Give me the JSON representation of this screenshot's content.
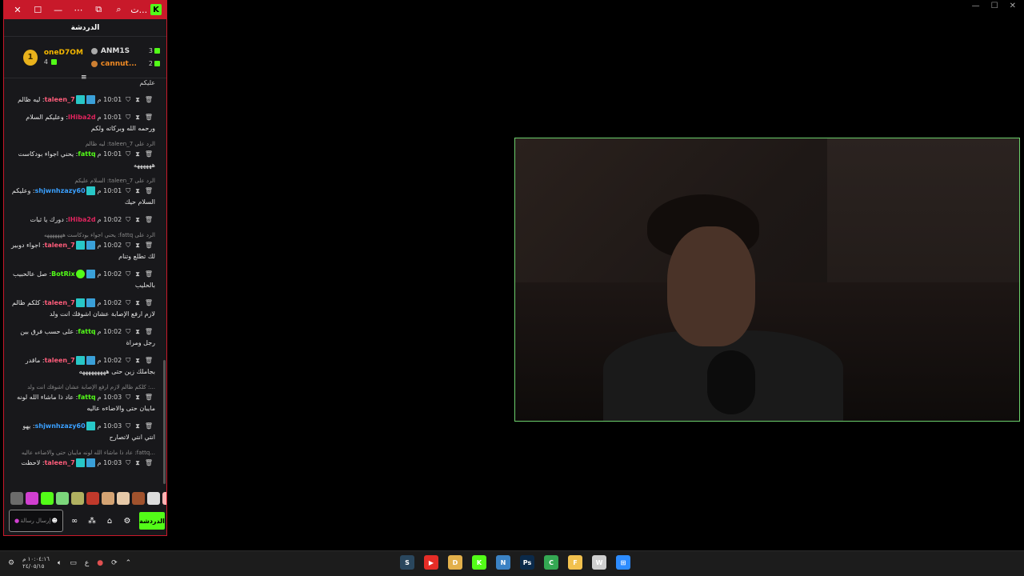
{
  "window": {
    "titlebar_buttons": [
      "close-icon",
      "maximize-icon",
      "minimize-icon",
      "more-icon",
      "popout-icon",
      "search-icon"
    ],
    "titlebar_text": "ت...",
    "brand": "K"
  },
  "chat": {
    "title": "الدردشة",
    "leaderboard": {
      "first": {
        "rank": "1",
        "name": "oneD7OM",
        "count": "4"
      },
      "second": {
        "name": "ANM1S",
        "count": "3"
      },
      "third": {
        "name": "cannut...",
        "count": "2"
      }
    },
    "top_line": "عليكم",
    "messages": [
      {
        "reply": "",
        "time": "10:01 م",
        "user": "taleen_7",
        "user_color": "#ff5c7a",
        "text": "ليه ظالم",
        "badges": [
          "b-blue",
          "b-teal"
        ]
      },
      {
        "reply": "",
        "time": "10:01 م",
        "user": "lHiba2d",
        "user_color": "#e0245e",
        "text": "وعليكم السلام ورحمه الله وبركاته ولكم",
        "badges": []
      },
      {
        "reply": "الرد على taleen_7: ليه ظالم",
        "time": "10:01 م",
        "user": "fattq",
        "user_color": "#53fc18",
        "text": "يحني اجواء بودكاست ههههههه",
        "badges": []
      },
      {
        "reply": "الرد على taleen_7: السلام عليكم",
        "time": "10:01 م",
        "user": "shjwnhzazy60",
        "user_color": "#3aa0ff",
        "text": "وعليكم السلام حيك",
        "badges": [
          "b-teal"
        ]
      },
      {
        "reply": "",
        "time": "10:02 م",
        "user": "lHiba2d",
        "user_color": "#e0245e",
        "text": "دورك يا ثبات",
        "badges": []
      },
      {
        "reply": "الرد على fattq: يحني اجواء بودكاست هههههههه",
        "time": "10:02 م",
        "user": "taleen_7",
        "user_color": "#ff5c7a",
        "text": "اجواء دوبير لك تطلع وتنام",
        "badges": [
          "b-blue",
          "b-teal"
        ]
      },
      {
        "reply": "",
        "time": "10:02 م",
        "user": "BotRix",
        "user_color": "#53fc18",
        "text": "صل عالحبيب بالحليب",
        "badges": [
          "b-blue",
          "b-green"
        ]
      },
      {
        "reply": "",
        "time": "10:02 م",
        "user": "taleen_7",
        "user_color": "#ff5c7a",
        "text": "كلكم ظالم لازم ارفع الإصابة عشان اشوفك انت ولد",
        "badges": [
          "b-blue",
          "b-teal"
        ]
      },
      {
        "reply": "",
        "time": "10:02 م",
        "user": "fattq",
        "user_color": "#53fc18",
        "text": "على حسب فرق بين رجل ومراة",
        "badges": []
      },
      {
        "reply": "",
        "time": "10:02 م",
        "user": "taleen_7",
        "user_color": "#ff5c7a",
        "text": "ماقدر بجاملك زين حتى هههههههههه",
        "badges": [
          "b-blue",
          "b-teal"
        ]
      },
      {
        "reply": "...: كلكم ظالم لازم ارفع الإصابة عشان اشوفك انت ولد",
        "time": "10:03 م",
        "user": "fattq",
        "user_color": "#53fc18",
        "text": "عاد ذا ماشاء الله لونه مايبان حتى والاضاءه عاليه",
        "badges": []
      },
      {
        "reply": "",
        "time": "10:03 م",
        "user": "shjwnhzazy60",
        "user_color": "#3aa0ff",
        "text": "يهو انتي انتي لاتصارح",
        "badges": [
          "b-teal"
        ]
      },
      {
        "reply": "...fattq: عاد ذا ماشاء الله لونه مايبان حتى والاضاءه عاليه",
        "time": "10:03 م",
        "user": "taleen_7",
        "user_color": "#ff5c7a",
        "text": "لاحظت",
        "badges": [
          "b-blue",
          "b-teal"
        ]
      }
    ],
    "emote_colors": [
      "#6b6b6b",
      "#d13fd1",
      "#53fc18",
      "#7bd67b",
      "#b0b060",
      "#c0392b",
      "#d4a373",
      "#e6c9a8",
      "#a0522d",
      "#dcdcdc",
      "#ffb3b3"
    ],
    "input_placeholder": "إرسال رسالة",
    "send_label": "الدردشة"
  },
  "taskbar": {
    "time": "١٠:٠٤:١٦ م",
    "date": "٢٤/٠٥/١٥",
    "lang": "ع",
    "apps": [
      {
        "name": "steam",
        "color": "#2a475e",
        "glyph": "S"
      },
      {
        "name": "youtube",
        "color": "#e52d27",
        "glyph": "▶"
      },
      {
        "name": "discord",
        "color": "#e3b04b",
        "glyph": "D"
      },
      {
        "name": "kick",
        "color": "#53fc18",
        "glyph": "K"
      },
      {
        "name": "notepad",
        "color": "#3b82c4",
        "glyph": "N"
      },
      {
        "name": "photoshop",
        "color": "#0b2a4a",
        "glyph": "Ps"
      },
      {
        "name": "chrome",
        "color": "#34a853",
        "glyph": "C"
      },
      {
        "name": "files",
        "color": "#f2c14e",
        "glyph": "F"
      },
      {
        "name": "window",
        "color": "#cfcfcf",
        "glyph": "W"
      },
      {
        "name": "start",
        "color": "#2d8cff",
        "glyph": "⊞"
      }
    ]
  }
}
